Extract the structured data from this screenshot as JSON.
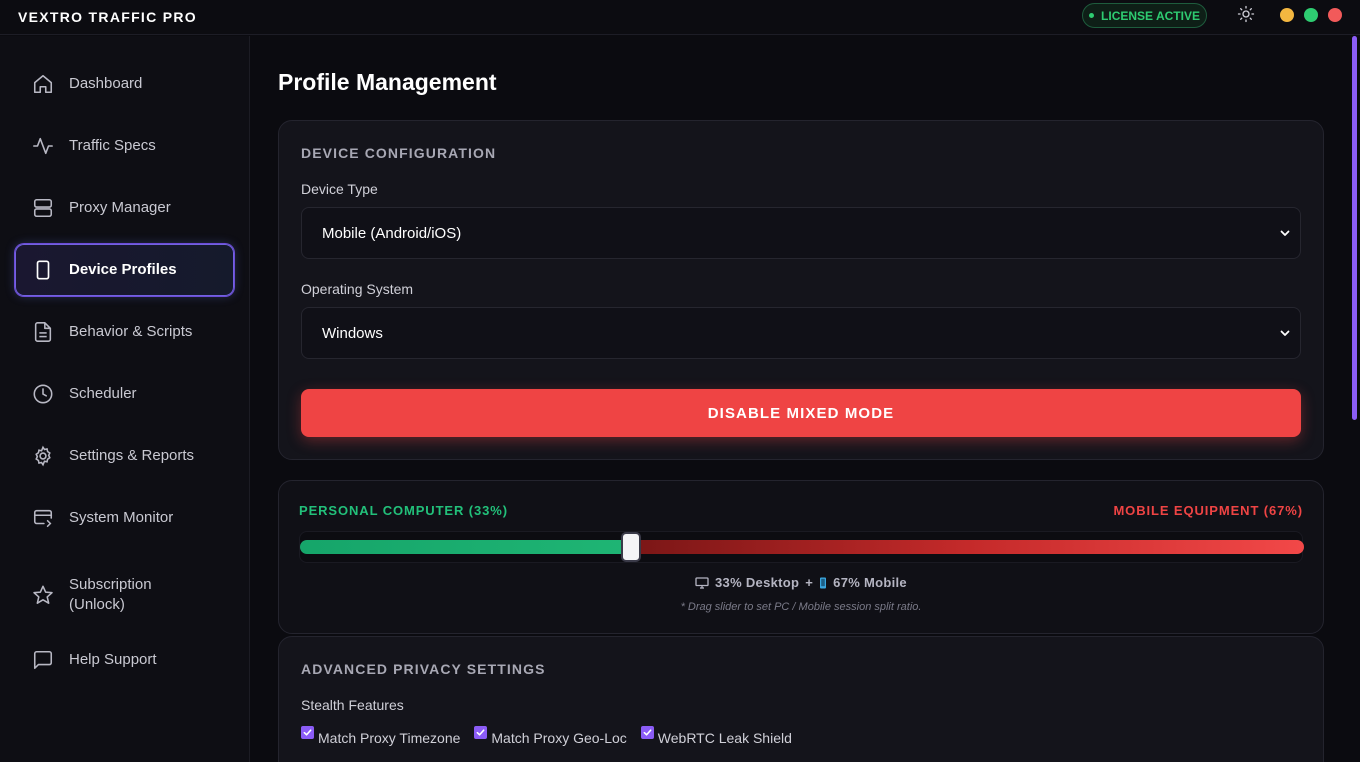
{
  "app": {
    "title": "VEXTRO TRAFFIC PRO",
    "license": "LICENSE ACTIVE"
  },
  "sidebar": {
    "items": [
      {
        "label": "Dashboard",
        "icon": "home-icon"
      },
      {
        "label": "Traffic Specs",
        "icon": "activity-icon"
      },
      {
        "label": "Proxy Manager",
        "icon": "server-icon"
      },
      {
        "label": "Device Profiles",
        "icon": "smartphone-icon",
        "active": true
      },
      {
        "label": "Behavior & Scripts",
        "icon": "file-text-icon"
      },
      {
        "label": "Scheduler",
        "icon": "clock-icon"
      },
      {
        "label": "Settings & Reports",
        "icon": "gear-icon"
      },
      {
        "label": "System Monitor",
        "icon": "monitor-icon"
      },
      {
        "label": "Subscription\n(Unlock)",
        "icon": "star-icon"
      },
      {
        "label": "Help Support",
        "icon": "message-square-icon"
      }
    ]
  },
  "main": {
    "title": "Profile Management",
    "device_config": {
      "section_title": "DEVICE CONFIGURATION",
      "device_type_label": "Device Type",
      "device_type_value": "Mobile (Android/iOS)",
      "os_label": "Operating System",
      "os_value": "Windows",
      "mixed_mode_button": "DISABLE MIXED MODE"
    },
    "split": {
      "left_label": "PERSONAL COMPUTER (33%)",
      "right_label": "MOBILE EQUIPMENT (67%)",
      "desktop_percent": 33,
      "summary_desktop": "33% Desktop",
      "summary_plus": "+",
      "summary_mobile": "67% Mobile",
      "hint": "* Drag slider to set PC / Mobile session split ratio."
    },
    "privacy": {
      "section_title": "ADVANCED PRIVACY SETTINGS",
      "stealth_label": "Stealth Features",
      "checkboxes": [
        {
          "label": "Match Proxy Timezone",
          "checked": true
        },
        {
          "label": "Match Proxy Geo-Loc",
          "checked": true
        },
        {
          "label": "WebRTC Leak Shield",
          "checked": true
        }
      ]
    }
  },
  "colors": {
    "accent": "#8b5cf6",
    "pc_green": "#22c07a",
    "mobile_red": "#ef4444",
    "license_green": "#2ecc71"
  }
}
